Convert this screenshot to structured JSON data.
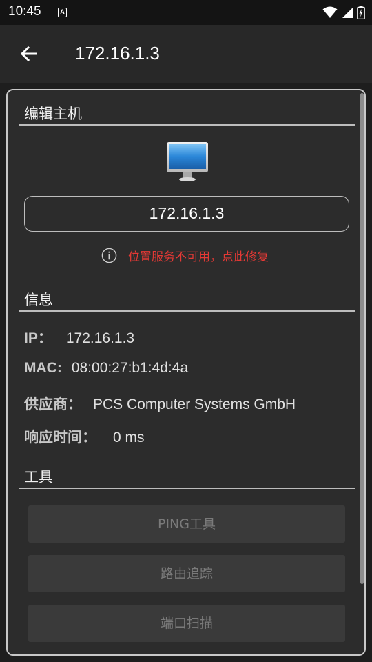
{
  "status_bar": {
    "time": "10:45",
    "notification_letter": "A",
    "icons": [
      "wifi-icon",
      "signal-icon",
      "battery-icon"
    ]
  },
  "toolbar": {
    "back_icon": "arrow-left-icon",
    "title": "172.16.1.3"
  },
  "edit_host": {
    "section_title": "编辑主机",
    "device_icon": "monitor-icon",
    "host_value": "172.16.1.3",
    "warning_icon": "info-icon",
    "warning_text": "位置服务不可用，点此修复"
  },
  "info": {
    "section_title": "信息",
    "ip_label": "IP：",
    "ip_value": "172.16.1.3",
    "mac_label": "MAC:",
    "mac_value": "08:00:27:b1:4d:4a",
    "vendor_label": "供应商：",
    "vendor_value": "PCS Computer Systems GmbH",
    "response_label": "响应时间：",
    "response_value": "0 ms"
  },
  "tools": {
    "section_title": "工具",
    "buttons": [
      "PING工具",
      "路由追踪",
      "端口扫描"
    ]
  },
  "colors": {
    "warning": "#e53935",
    "background": "#1e1e1e",
    "card": "#2c2c2c"
  }
}
